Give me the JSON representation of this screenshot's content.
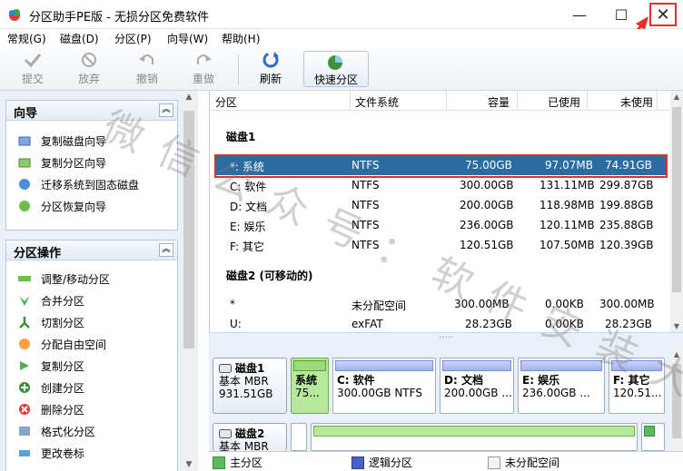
{
  "window": {
    "title": "分区助手PE版 - 无损分区免费软件"
  },
  "menu": [
    "常规(G)",
    "磁盘(D)",
    "分区(P)",
    "向导(W)",
    "帮助(H)"
  ],
  "toolbar": {
    "submit": "提交",
    "discard": "放弃",
    "undo": "撤销",
    "redo": "重做",
    "refresh": "刷新",
    "quick": "快速分区"
  },
  "wizard": {
    "title": "向导",
    "items": [
      "复制磁盘向导",
      "复制分区向导",
      "迁移系统到固态磁盘",
      "分区恢复向导"
    ]
  },
  "ops": {
    "title": "分区操作",
    "items": [
      "调整/移动分区",
      "合并分区",
      "切割分区",
      "分配自由空间",
      "复制分区",
      "创建分区",
      "删除分区",
      "格式化分区",
      "更改卷标"
    ]
  },
  "columns": {
    "part": "分区",
    "fs": "文件系统",
    "cap": "容量",
    "used": "已使用",
    "unused": "未使用"
  },
  "disk1": {
    "label": "磁盘1",
    "rows": [
      {
        "name": "*: 系统",
        "fs": "NTFS",
        "cap": "75.00GB",
        "used": "97.07MB",
        "unused": "74.91GB"
      },
      {
        "name": "C: 软件",
        "fs": "NTFS",
        "cap": "300.00GB",
        "used": "131.11MB",
        "unused": "299.87GB"
      },
      {
        "name": "D: 文档",
        "fs": "NTFS",
        "cap": "200.00GB",
        "used": "118.98MB",
        "unused": "199.88GB"
      },
      {
        "name": "E: 娱乐",
        "fs": "NTFS",
        "cap": "236.00GB",
        "used": "120.11MB",
        "unused": "235.88GB"
      },
      {
        "name": "F: 其它",
        "fs": "NTFS",
        "cap": "120.51GB",
        "used": "107.50MB",
        "unused": "120.39GB"
      }
    ]
  },
  "disk2": {
    "label": "磁盘2 (可移动的)",
    "rows": [
      {
        "name": "*",
        "fs": "未分配空间",
        "cap": "300.00MB",
        "used": "0.00KB",
        "unused": "300.00MB"
      },
      {
        "name": "U:",
        "fs": "exFAT",
        "cap": "28.23GB",
        "used": "0.00KB",
        "unused": "28.23GB"
      }
    ]
  },
  "map": {
    "disk1": {
      "name": "磁盘1",
      "type": "基本 MBR",
      "size": "931.51GB"
    },
    "disk1_parts": [
      {
        "name": "系统",
        "detail": "75..."
      },
      {
        "name": "C: 软件",
        "detail": "300.00GB NTFS"
      },
      {
        "name": "D: 文档",
        "detail": "200.00GB ..."
      },
      {
        "name": "E: 娱乐",
        "detail": "236.00GB ..."
      },
      {
        "name": "F: 其它",
        "detail": "120.51..."
      }
    ],
    "disk2": {
      "name": "磁盘2",
      "type": "基本 MBR"
    }
  },
  "legend": {
    "primary": "主分区",
    "logical": "逻辑分区",
    "unalloc": "未分配空间"
  },
  "watermark": "微信公众号：软件安装大神",
  "colors": {
    "selection": "#2b6ca3",
    "highlight": "#e4302b",
    "primary": "#5cb85c",
    "logical": "#4a5fc9"
  }
}
